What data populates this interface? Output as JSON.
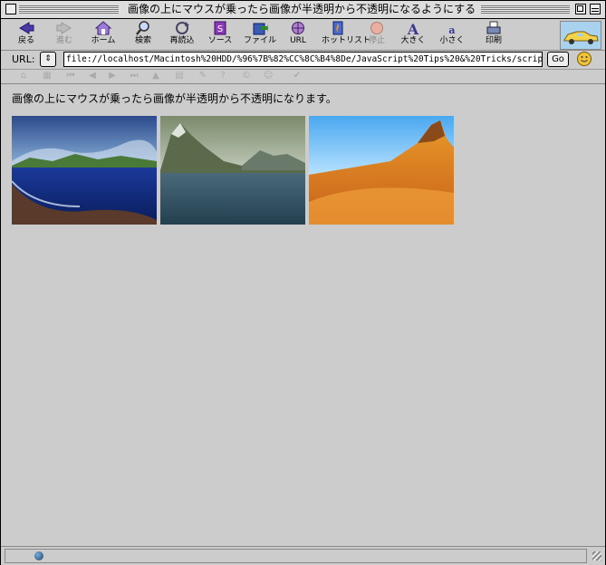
{
  "window": {
    "title": "画像の上にマウスが乗ったら画像が半透明から不透明になるようにする"
  },
  "toolbar": {
    "buttons": [
      {
        "label": "戻る",
        "icon": "back-arrow-icon",
        "enabled": true
      },
      {
        "label": "進む",
        "icon": "forward-arrow-icon",
        "enabled": false
      },
      {
        "label": "ホーム",
        "icon": "home-icon",
        "enabled": true
      },
      {
        "label": "検索",
        "icon": "search-icon",
        "enabled": true
      },
      {
        "label": "再読込",
        "icon": "reload-icon",
        "enabled": true
      },
      {
        "label": "ソース",
        "icon": "source-icon",
        "enabled": true
      },
      {
        "label": "ファイル",
        "icon": "file-icon",
        "enabled": true
      },
      {
        "label": "URL",
        "icon": "url-icon",
        "enabled": true
      },
      {
        "label": "ホットリスト",
        "icon": "hotlist-icon",
        "enabled": true
      },
      {
        "label": "停止",
        "icon": "stop-icon",
        "enabled": false
      },
      {
        "label": "大きく",
        "icon": "font-larger-icon",
        "enabled": true
      },
      {
        "label": "小さく",
        "icon": "font-smaller-icon",
        "enabled": true
      },
      {
        "label": "印刷",
        "icon": "print-icon",
        "enabled": true
      }
    ]
  },
  "urlbar": {
    "label": "URL:",
    "value": "file://localhost/Macintosh%20HDD/%96%7B%82%CC%8C%B4%8De/JavaScript%20Tips%20&%20Tricks/scrip",
    "go_label": "Go"
  },
  "content": {
    "caption": "画像の上にマウスが乗ったら画像が半透明から不透明になります。",
    "images": [
      {
        "alt": "coastal-landscape",
        "opacity_state": "translucent"
      },
      {
        "alt": "mountain-lake-landscape",
        "opacity_state": "translucent"
      },
      {
        "alt": "orange-desert-peak-landscape",
        "opacity_state": "translucent"
      }
    ]
  }
}
